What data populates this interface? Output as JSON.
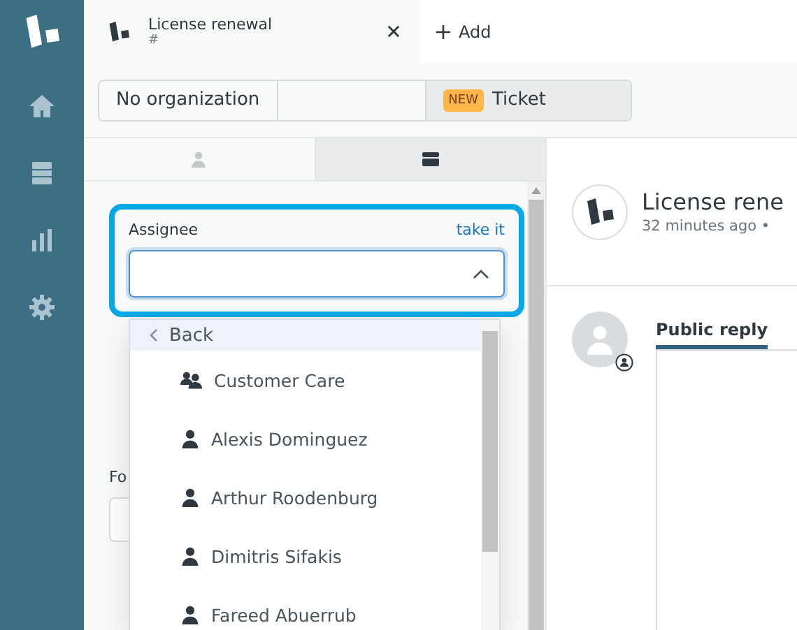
{
  "tabs": [
    {
      "title": "License renewal",
      "subtitle": "#",
      "selected": true
    }
  ],
  "add_tab": {
    "label": "Add"
  },
  "breadcrumb": [
    {
      "kind": "text",
      "label": "No organization"
    },
    {
      "kind": "blank"
    },
    {
      "kind": "badge",
      "badge": "NEW",
      "label": "Ticket"
    }
  ],
  "panel_tabs": [
    {
      "kind": "user",
      "selected": false
    },
    {
      "kind": "layout",
      "selected": true
    }
  ],
  "assignee": {
    "label": "Assignee",
    "action": "take it",
    "expanded": true,
    "options": [
      {
        "kind": "back",
        "label": "Back"
      },
      {
        "kind": "group",
        "label": "Customer Care"
      },
      {
        "kind": "agent",
        "label": "Alexis Dominguez"
      },
      {
        "kind": "agent",
        "label": "Arthur Roodenburg"
      },
      {
        "kind": "agent",
        "label": "Dimitris Sifakis"
      },
      {
        "kind": "agent",
        "label": "Fareed Abuerrub"
      }
    ]
  },
  "form": {
    "label": "Fo"
  },
  "ticket": {
    "title": "License rene",
    "meta": "32 minutes ago •"
  },
  "composer": {
    "tabs": [
      {
        "label": "Public reply",
        "selected": true
      }
    ]
  }
}
